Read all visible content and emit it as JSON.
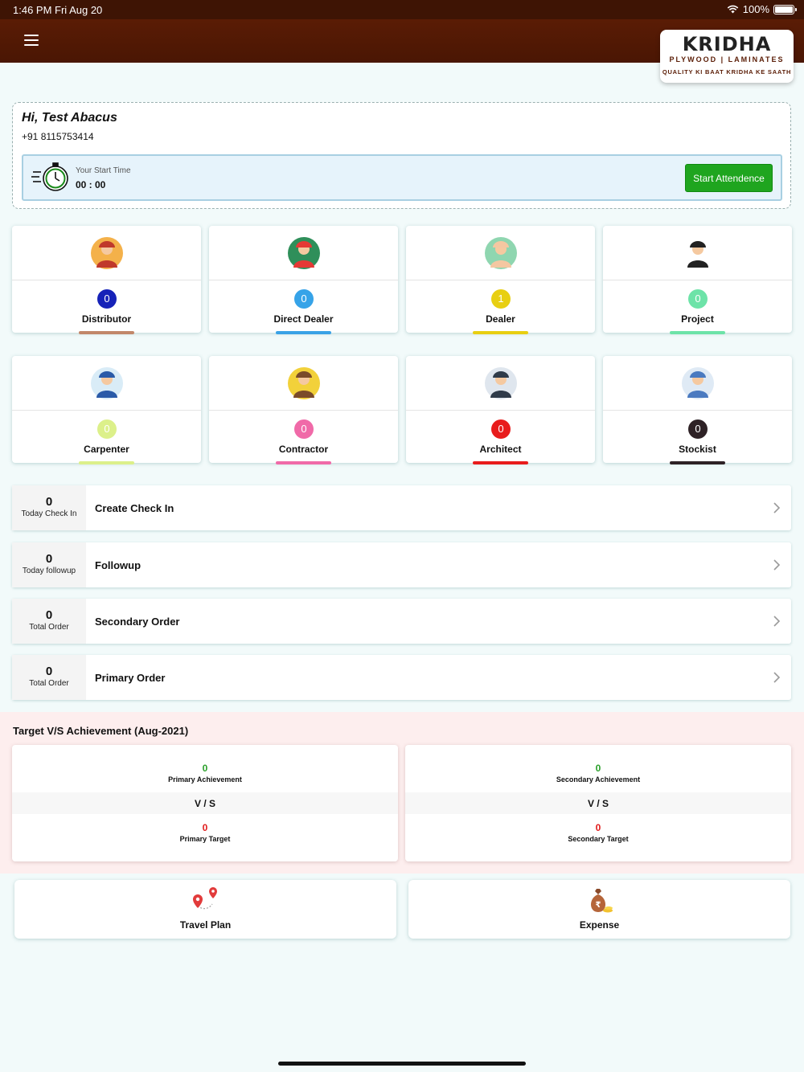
{
  "status_bar": {
    "time": "1:46 PM   Fri Aug 20",
    "battery": "100%"
  },
  "logo": {
    "brand": "KRIDHA",
    "sub": "PLYWOOD | LAMINATES",
    "tagline": "QUALITY KI BAAT KRIDHA KE SAATH"
  },
  "user": {
    "greeting": "Hi, Test Abacus",
    "phone": "+91 8115753414"
  },
  "attendance": {
    "label": "Your Start Time",
    "time": "00 : 00",
    "button": "Start Attendence"
  },
  "categories": [
    {
      "name": "Distributor",
      "count": "0",
      "color": "#1622b8",
      "bar": "#c2876a",
      "icon": "distributor-icon"
    },
    {
      "name": "Direct Dealer",
      "count": "0",
      "color": "#36a3e8",
      "bar": "#3aa2e6",
      "icon": "direct-dealer-icon"
    },
    {
      "name": "Dealer",
      "count": "1",
      "color": "#e8cf12",
      "bar": "#e8cf12",
      "icon": "dealer-icon"
    },
    {
      "name": "Project",
      "count": "0",
      "color": "#6de3a8",
      "bar": "#6de3a8",
      "icon": "project-icon"
    },
    {
      "name": "Carpenter",
      "count": "0",
      "color": "#dcf08a",
      "bar": "#dcf08a",
      "icon": "carpenter-icon"
    },
    {
      "name": "Contractor",
      "count": "0",
      "color": "#f06aa8",
      "bar": "#f06aa8",
      "icon": "contractor-icon"
    },
    {
      "name": "Architect",
      "count": "0",
      "color": "#e81c1c",
      "bar": "#e81c1c",
      "icon": "architect-icon"
    },
    {
      "name": "Stockist",
      "count": "0",
      "color": "#2e2226",
      "bar": "#2e2226",
      "icon": "stockist-icon"
    }
  ],
  "activity_rows": [
    {
      "count": "0",
      "caption": "Today Check In",
      "title": "Create Check In"
    },
    {
      "count": "0",
      "caption": "Today followup",
      "title": "Followup"
    },
    {
      "count": "0",
      "caption": "Total Order",
      "title": "Secondary Order"
    },
    {
      "count": "0",
      "caption": "Total Order",
      "title": "Primary Order"
    }
  ],
  "target": {
    "heading": "Target V/S Achievement (Aug-2021)",
    "vs": "V / S",
    "primary": {
      "achievement": "0",
      "achievement_label": "Primary Achievement",
      "target": "0",
      "target_label": "Primary Target"
    },
    "secondary": {
      "achievement": "0",
      "achievement_label": "Secondary Achievement",
      "target": "0",
      "target_label": "Secondary Target"
    }
  },
  "bottom_actions": [
    {
      "label": "Travel Plan",
      "icon": "travel-plan-icon"
    },
    {
      "label": "Expense",
      "icon": "expense-icon"
    }
  ]
}
